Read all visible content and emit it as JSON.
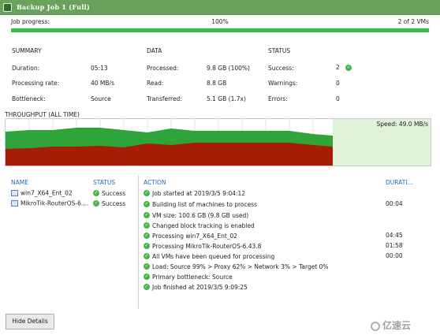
{
  "window": {
    "title": "Backup Job 1 (Full)"
  },
  "job": {
    "progress_label": "Job progress:",
    "progress_percent": "100%",
    "progress_fraction": 1.0,
    "vm_count": "2 of 2 VMs"
  },
  "summary": {
    "title": "SUMMARY",
    "rows": [
      {
        "label": "Duration:",
        "value": "05:13"
      },
      {
        "label": "Processing rate:",
        "value": "40 MB/s"
      },
      {
        "label": "Bottleneck:",
        "value": "Source"
      }
    ]
  },
  "data_section": {
    "title": "DATA",
    "rows": [
      {
        "label": "Processed:",
        "value": "9.8 GB (100%)"
      },
      {
        "label": "Read:",
        "value": "8.8 GB"
      },
      {
        "label": "Transferred:",
        "value": "5.1 GB (1.7x)"
      }
    ]
  },
  "status_section": {
    "title": "STATUS",
    "rows": [
      {
        "label": "Success:",
        "value": "2"
      },
      {
        "label": "Warnings:",
        "value": "0"
      },
      {
        "label": "Errors:",
        "value": "0"
      }
    ]
  },
  "throughput": {
    "title": "THROUGHPUT (ALL TIME)",
    "speed": "Speed: 49.0 MB/s",
    "colors": {
      "read": "#2ea43b",
      "transfer": "#a51d05",
      "background": "#dff3d8"
    }
  },
  "vms": {
    "headers": {
      "name": "NAME",
      "status": "STATUS"
    },
    "items": [
      {
        "name": "win7_X64_Ent_02",
        "status": "Success"
      },
      {
        "name": "MikroTik-RouterOS-6....",
        "status": "Success"
      }
    ]
  },
  "actions": {
    "headers": {
      "action": "ACTION",
      "duration": "DURATI..."
    },
    "items": [
      {
        "text": "Job started at 2019/3/5 9:04:12",
        "duration": ""
      },
      {
        "text": "Building list of machines to process",
        "duration": "00:04"
      },
      {
        "text": "VM size: 100.6 GB (9.8 GB used)",
        "duration": ""
      },
      {
        "text": "Changed block tracking is enabled",
        "duration": ""
      },
      {
        "text": "Processing win7_X64_Ent_02",
        "duration": "04:45"
      },
      {
        "text": "Processing MikroTik-RouterOS-6.43.8",
        "duration": "01:58"
      },
      {
        "text": "All VMs have been queued for processing",
        "duration": "00:00"
      },
      {
        "text": "Load: Source 99% > Proxy 62% > Network 3% > Target 0%",
        "duration": ""
      },
      {
        "text": "Primary bottleneck: Source",
        "duration": ""
      },
      {
        "text": "Job finished at 2019/3/5 9:09:25",
        "duration": ""
      }
    ]
  },
  "footer": {
    "hide_details": "Hide Details",
    "watermark": "亿速云"
  }
}
